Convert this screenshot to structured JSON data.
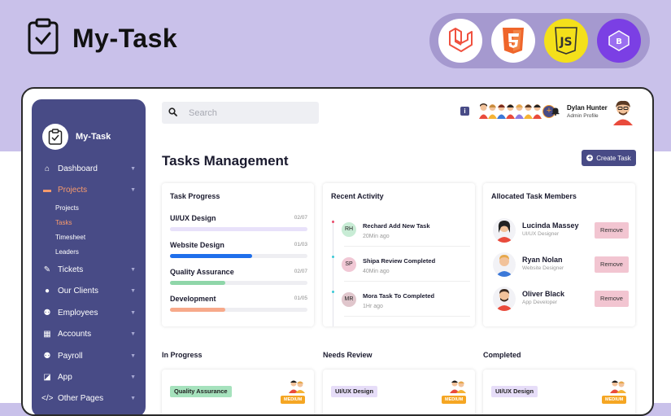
{
  "brand": {
    "title": "My-Task",
    "icon": "clipboard-check-icon"
  },
  "tech_icons": [
    "laravel-icon",
    "html5-icon",
    "javascript-icon",
    "bootstrap-icon"
  ],
  "colors": {
    "accent": "#484b86",
    "active": "#f79a6c",
    "background": "#c9c1ea"
  },
  "sidebar": {
    "logo_text": "My-Task",
    "items": [
      {
        "label": "Dashboard",
        "icon": "home-icon"
      },
      {
        "label": "Projects",
        "icon": "briefcase-icon",
        "active": true
      },
      {
        "label": "Tickets",
        "icon": "ticket-icon"
      },
      {
        "label": "Our Clients",
        "icon": "user-icon"
      },
      {
        "label": "Employees",
        "icon": "users-icon"
      },
      {
        "label": "Accounts",
        "icon": "calculator-icon"
      },
      {
        "label": "Payroll",
        "icon": "users-icon"
      },
      {
        "label": "App",
        "icon": "app-icon"
      },
      {
        "label": "Other Pages",
        "icon": "code-icon"
      }
    ],
    "subitems": [
      {
        "label": "Projects"
      },
      {
        "label": "Tasks",
        "active": true
      },
      {
        "label": "Timesheet"
      },
      {
        "label": "Leaders"
      }
    ]
  },
  "search": {
    "placeholder": "Search"
  },
  "user": {
    "name": "Dylan Hunter",
    "role": "Admin Profile"
  },
  "page": {
    "title": "Tasks Management",
    "create_label": "Create Task"
  },
  "task_progress": {
    "title": "Task Progress",
    "items": [
      {
        "name": "UI/UX Design",
        "count": "02/07",
        "progress": 1.0,
        "color": "#e8e1fa"
      },
      {
        "name": "Website Design",
        "count": "01/03",
        "progress": 0.6,
        "color": "#1f6feb"
      },
      {
        "name": "Quality Assurance",
        "count": "02/07",
        "progress": 0.4,
        "color": "#8fd6a9"
      },
      {
        "name": "Development",
        "count": "01/05",
        "progress": 0.4,
        "color": "#f7a98a"
      }
    ]
  },
  "recent_activity": {
    "title": "Recent Activity",
    "items": [
      {
        "initials": "RH",
        "title": "Rechard Add New Task",
        "time": "20Min ago",
        "color": "#c8ecd5",
        "dot": "#e94b6a"
      },
      {
        "initials": "SP",
        "title": "Shipa Review Completed",
        "time": "40Min ago",
        "color": "#f1c8d5",
        "dot": "#3bc9d6"
      },
      {
        "initials": "MR",
        "title": "Mora Task To Completed",
        "time": "1Hr ago",
        "color": "#e0c6cc",
        "dot": "#3bc9d6"
      }
    ]
  },
  "members": {
    "title": "Allocated Task Members",
    "remove_label": "Remove",
    "items": [
      {
        "name": "Lucinda Massey",
        "role": "UI/UX Designer"
      },
      {
        "name": "Ryan Nolan",
        "role": "Website Designer"
      },
      {
        "name": "Oliver Black",
        "role": "App Developer"
      }
    ]
  },
  "columns": [
    {
      "title": "In Progress",
      "tag": "Quality Assurance",
      "tag_color": "#a6e2bd",
      "priority": "MEDIUM"
    },
    {
      "title": "Needs Review",
      "tag": "UI/UX Design",
      "tag_color": "#e6ddf8",
      "priority": "MEDIUM"
    },
    {
      "title": "Completed",
      "tag": "UI/UX Design",
      "tag_color": "#e6ddf8",
      "priority": "MEDIUM"
    }
  ]
}
